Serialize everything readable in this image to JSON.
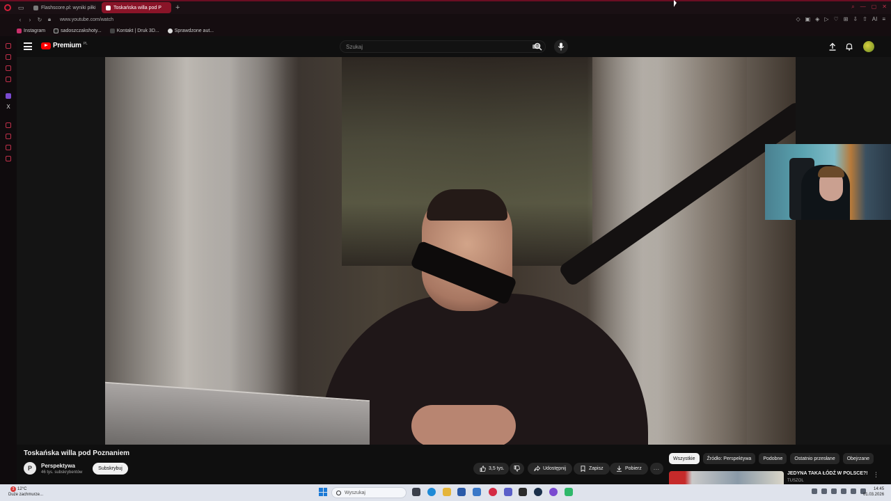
{
  "browser": {
    "tabs": [
      {
        "label": "Flashscore.pl: wyniki piłki",
        "active": false
      },
      {
        "label": "Toskańska willa pod P",
        "active": true
      }
    ],
    "url": "www.youtube.com/watch",
    "bookmarks": [
      "Instagram",
      "sadoszczakshoty...",
      "Kontakt | Druk 3D...",
      "Sprawdzone aut..."
    ]
  },
  "youtube": {
    "brand": "Premium",
    "country": "PL",
    "search_placeholder": "Szukaj"
  },
  "video": {
    "title": "Toskańska willa pod Poznaniem",
    "channel": {
      "avatar_letter": "P",
      "name": "Perspektywa",
      "subscribers": "46 tys. subskrybentów"
    },
    "subscribe_label": "Subskrybuj",
    "actions": {
      "likes": "3,5 tys.",
      "share": "Udostępnij",
      "save": "Zapisz",
      "download": "Pobierz",
      "more": "..."
    }
  },
  "chips": [
    {
      "label": "Wszystkie",
      "active": true
    },
    {
      "label": "Źródło: Perspektywa",
      "active": false
    },
    {
      "label": "Podobne",
      "active": false
    },
    {
      "label": "Ostatnio przesłane",
      "active": false
    },
    {
      "label": "Obejrzane",
      "active": false
    }
  ],
  "recommendation": {
    "title": "JEDYNA TAKA ŁÓDŹ W POLSCE?!",
    "channel": "TUSZOL"
  },
  "taskbar": {
    "weather_temp": "12°C",
    "weather_desc": "Duże zachmurze...",
    "weather_badge": "3",
    "search_placeholder": "Wyszukaj",
    "time": "14:45",
    "date": "01.03.2026"
  },
  "colors": {
    "opera_accent": "#8a1428",
    "youtube_red": "#ff0000",
    "taskbar_bg": "#dfe3ec"
  }
}
